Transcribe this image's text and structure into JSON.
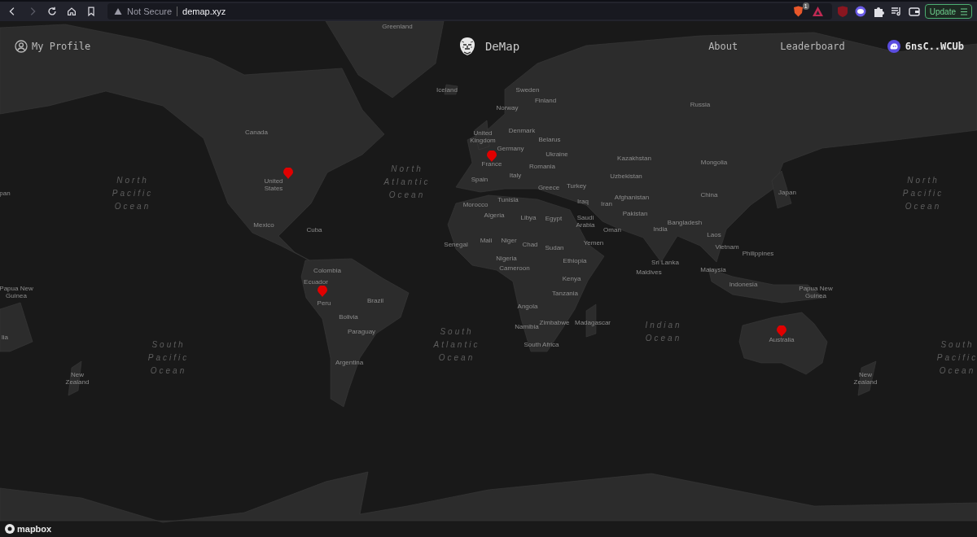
{
  "browser": {
    "forward_enabled": false,
    "security_label": "Not Secure",
    "url": "demap.xyz",
    "extension_badge": "1",
    "update_button": "Update"
  },
  "header": {
    "profile_link": "My Profile",
    "brand": "DeMap",
    "nav": [
      "About",
      "Leaderboard"
    ],
    "wallet": "6nsC..WCUb"
  },
  "map": {
    "labels": [
      {
        "text": "Greenland",
        "kind": "country"
      },
      {
        "text": "Canada",
        "kind": "country"
      },
      {
        "text": "United States",
        "kind": "country"
      },
      {
        "text": "Mexico",
        "kind": "country"
      },
      {
        "text": "Cuba",
        "kind": "country"
      },
      {
        "text": "Colombia",
        "kind": "country"
      },
      {
        "text": "Ecuador",
        "kind": "country"
      },
      {
        "text": "Peru",
        "kind": "country"
      },
      {
        "text": "Brazil",
        "kind": "country"
      },
      {
        "text": "Bolivia",
        "kind": "country"
      },
      {
        "text": "Paraguay",
        "kind": "country"
      },
      {
        "text": "Argentina",
        "kind": "country"
      },
      {
        "text": "Iceland",
        "kind": "country"
      },
      {
        "text": "Sweden",
        "kind": "country"
      },
      {
        "text": "Finland",
        "kind": "country"
      },
      {
        "text": "Norway",
        "kind": "country"
      },
      {
        "text": "United Kingdom",
        "kind": "country"
      },
      {
        "text": "Denmark",
        "kind": "country"
      },
      {
        "text": "Germany",
        "kind": "country"
      },
      {
        "text": "France",
        "kind": "country"
      },
      {
        "text": "Belarus",
        "kind": "country"
      },
      {
        "text": "Ukraine",
        "kind": "country"
      },
      {
        "text": "Romania",
        "kind": "country"
      },
      {
        "text": "Italy",
        "kind": "country"
      },
      {
        "text": "Spain",
        "kind": "country"
      },
      {
        "text": "Greece",
        "kind": "country"
      },
      {
        "text": "Turkey",
        "kind": "country"
      },
      {
        "text": "Morocco",
        "kind": "country"
      },
      {
        "text": "Tunisia",
        "kind": "country"
      },
      {
        "text": "Algeria",
        "kind": "country"
      },
      {
        "text": "Libya",
        "kind": "country"
      },
      {
        "text": "Egypt",
        "kind": "country"
      },
      {
        "text": "Senegal",
        "kind": "country"
      },
      {
        "text": "Mali",
        "kind": "country"
      },
      {
        "text": "Niger",
        "kind": "country"
      },
      {
        "text": "Chad",
        "kind": "country"
      },
      {
        "text": "Sudan",
        "kind": "country"
      },
      {
        "text": "Nigeria",
        "kind": "country"
      },
      {
        "text": "Cameroon",
        "kind": "country"
      },
      {
        "text": "Ethiopia",
        "kind": "country"
      },
      {
        "text": "Kenya",
        "kind": "country"
      },
      {
        "text": "Tanzania",
        "kind": "country"
      },
      {
        "text": "Angola",
        "kind": "country"
      },
      {
        "text": "Zimbabwe",
        "kind": "country"
      },
      {
        "text": "Namibia",
        "kind": "country"
      },
      {
        "text": "Madagascar",
        "kind": "country"
      },
      {
        "text": "South Africa",
        "kind": "country"
      },
      {
        "text": "Iraq",
        "kind": "country"
      },
      {
        "text": "Saudi Arabia",
        "kind": "country"
      },
      {
        "text": "Iran",
        "kind": "country"
      },
      {
        "text": "Oman",
        "kind": "country"
      },
      {
        "text": "Yemen",
        "kind": "country"
      },
      {
        "text": "Kazakhstan",
        "kind": "country"
      },
      {
        "text": "Uzbekistan",
        "kind": "country"
      },
      {
        "text": "Afghanistan",
        "kind": "country"
      },
      {
        "text": "Pakistan",
        "kind": "country"
      },
      {
        "text": "Russia",
        "kind": "country"
      },
      {
        "text": "Mongolia",
        "kind": "country"
      },
      {
        "text": "China",
        "kind": "country"
      },
      {
        "text": "Japan",
        "kind": "country"
      },
      {
        "text": "India",
        "kind": "country"
      },
      {
        "text": "Bangladesh",
        "kind": "country"
      },
      {
        "text": "Laos",
        "kind": "country"
      },
      {
        "text": "Vietnam",
        "kind": "country"
      },
      {
        "text": "Sri Lanka",
        "kind": "country"
      },
      {
        "text": "Maldives",
        "kind": "country"
      },
      {
        "text": "Philippines",
        "kind": "country"
      },
      {
        "text": "Malaysia",
        "kind": "country"
      },
      {
        "text": "Indonesia",
        "kind": "country"
      },
      {
        "text": "Papua New Guinea",
        "kind": "country"
      },
      {
        "text": "Papua New Guinea",
        "kind": "country"
      },
      {
        "text": "Australia",
        "kind": "country"
      },
      {
        "text": "New Zealand",
        "kind": "country"
      },
      {
        "text": "New Zealand",
        "kind": "country"
      },
      {
        "text": "pan",
        "kind": "country"
      },
      {
        "text": "lia",
        "kind": "country"
      },
      {
        "text": "North Pacific Ocean",
        "kind": "ocean"
      },
      {
        "text": "North Atlantic Ocean",
        "kind": "ocean"
      },
      {
        "text": "South Pacific Ocean",
        "kind": "ocean"
      },
      {
        "text": "South Atlantic Ocean",
        "kind": "ocean"
      },
      {
        "text": "Indian Ocean",
        "kind": "ocean"
      },
      {
        "text": "North Pacific Ocean",
        "kind": "ocean"
      },
      {
        "text": "South Pacific Ocean",
        "kind": "ocean"
      }
    ],
    "attribution": "mapbox"
  }
}
